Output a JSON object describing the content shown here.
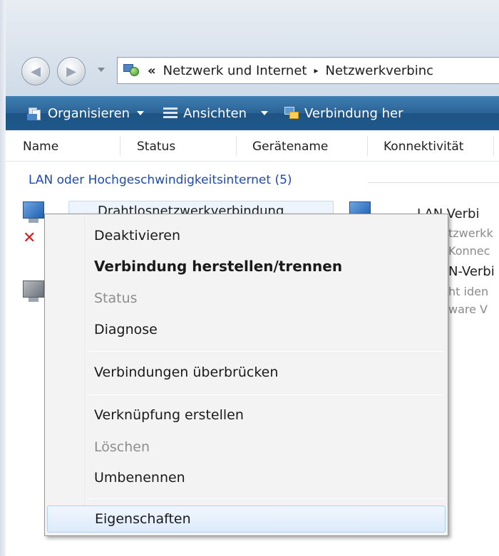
{
  "address_bar": {
    "chevron": "«",
    "crumb1": "Netzwerk und Internet",
    "separator": "▸",
    "crumb2": "Netzwerkverbinc"
  },
  "toolbar": {
    "organize_label": "Organisieren",
    "views_label": "Ansichten",
    "connect_label": "Verbindung her"
  },
  "columns": {
    "name": "Name",
    "status": "Status",
    "device": "Gerätename",
    "connectivity": "Konnektivität"
  },
  "group": {
    "header": "LAN oder Hochgeschwindigkeitsinternet (5)"
  },
  "items": {
    "selected_title": "Drahtlosnetzwerkverbindung",
    "right1_title": "LAN-Verbi",
    "right1_sub1": "tzwerkk",
    "right1_sub2": "Konnec",
    "right2_title": "N-Verbi",
    "right2_sub1": "ht iden",
    "right2_sub2": "ware V"
  },
  "context_menu": {
    "items": [
      {
        "label": "Deaktivieren",
        "state": "normal"
      },
      {
        "label": "Verbindung herstellen/trennen",
        "state": "default"
      },
      {
        "label": "Status",
        "state": "disabled"
      },
      {
        "label": "Diagnose",
        "state": "normal"
      },
      {
        "label": "Verbindungen überbrücken",
        "state": "normal"
      },
      {
        "label": "Verknüpfung erstellen",
        "state": "normal"
      },
      {
        "label": "Löschen",
        "state": "disabled"
      },
      {
        "label": "Umbenennen",
        "state": "normal"
      },
      {
        "label": "Eigenschaften",
        "state": "hover"
      }
    ]
  },
  "colors": {
    "toolbar": "#1f5a8c",
    "group_header": "#1f4aa8",
    "menu_bg": "#f3f3f3",
    "menu_hover": "#dcebfb"
  }
}
